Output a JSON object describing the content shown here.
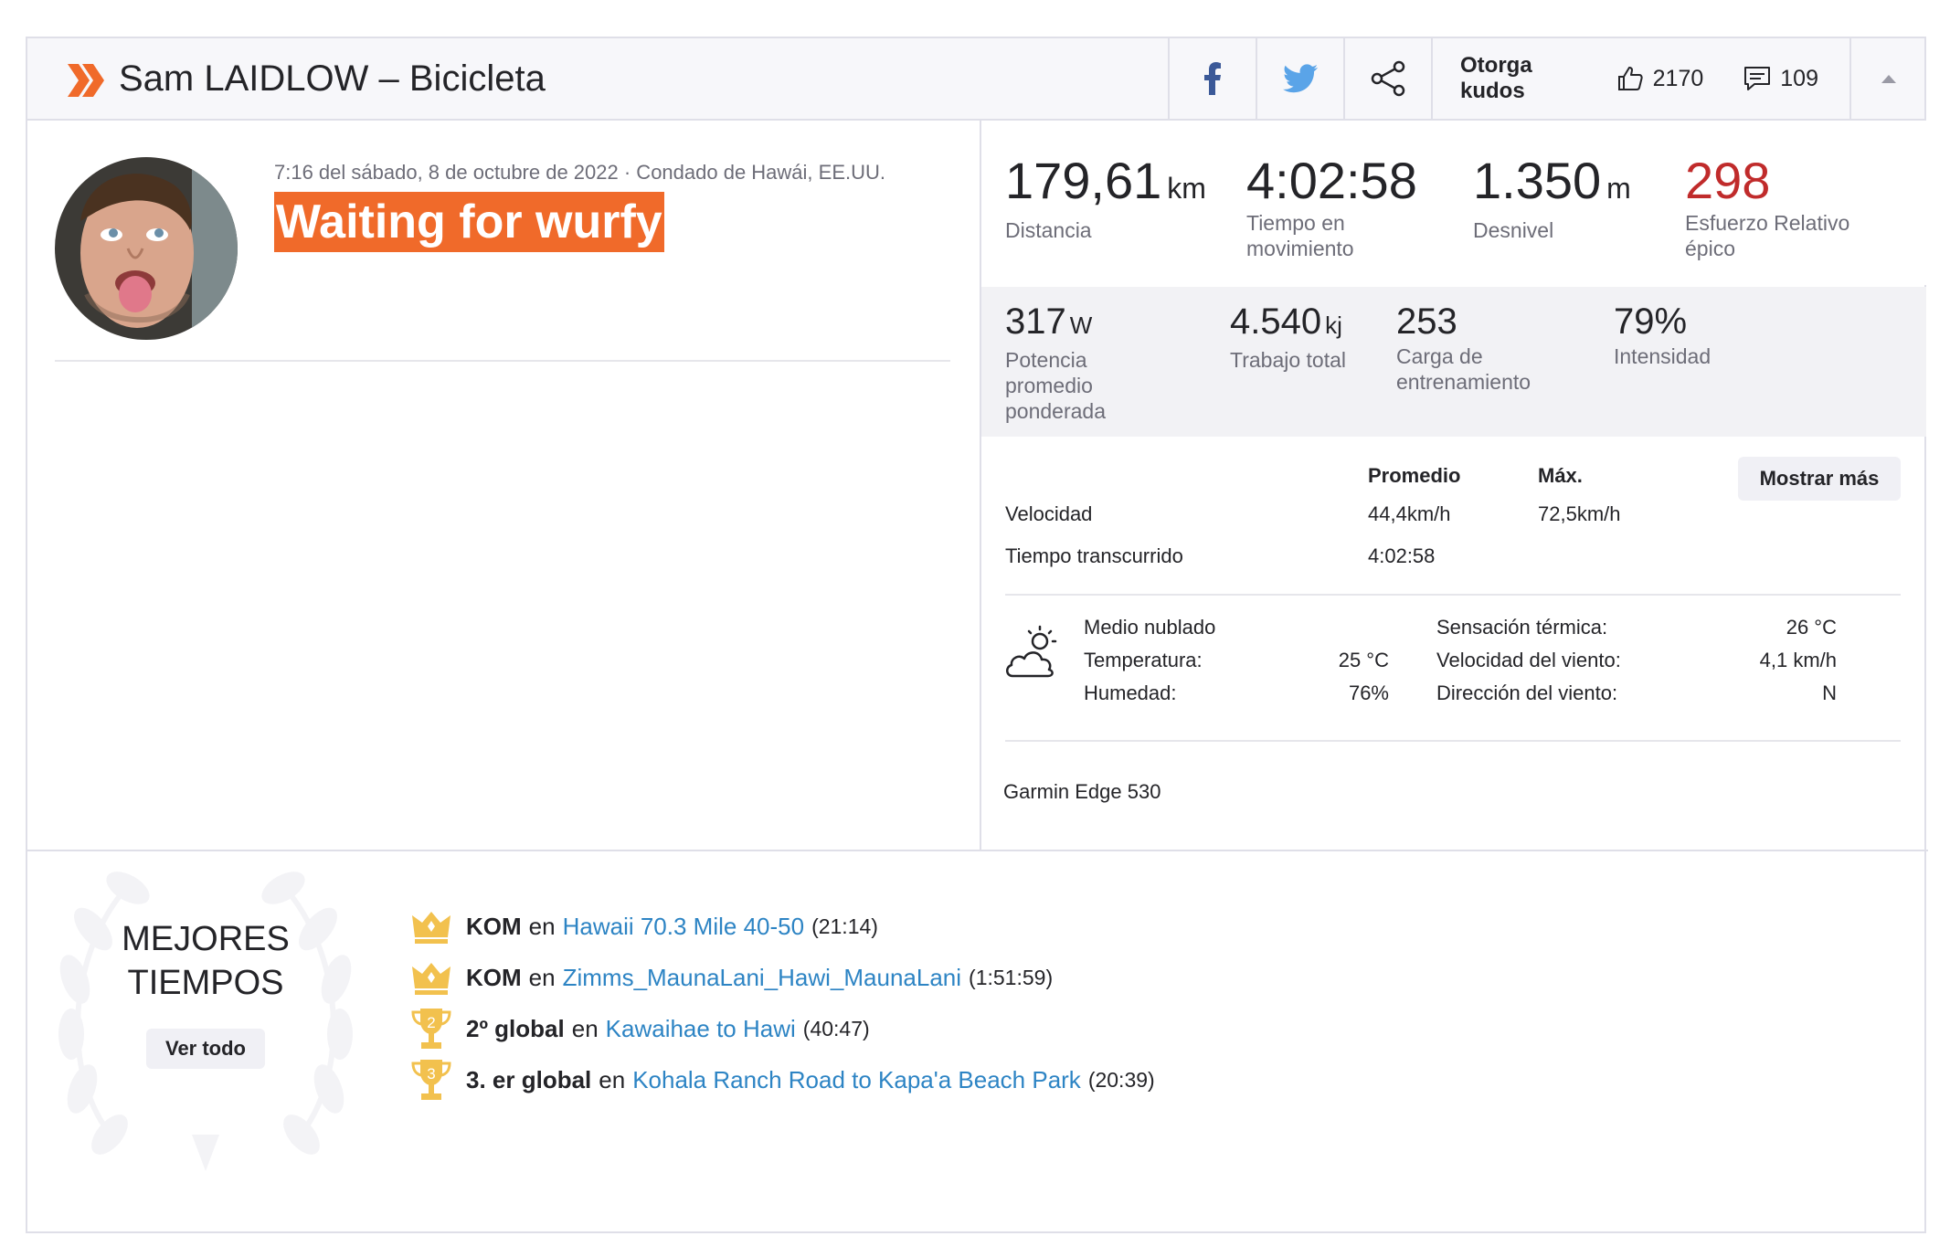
{
  "header": {
    "title": "Sam LAIDLOW – Bicicleta",
    "kudos_label": "Otorga kudos",
    "kudos_count": "2170",
    "comment_count": "109",
    "icons": [
      "strava-logo-icon",
      "facebook-icon",
      "twitter-icon",
      "share-icon",
      "thumbs-up-icon",
      "comment-icon",
      "caret-up-icon"
    ]
  },
  "activity": {
    "dateline": "7:16 del sábado, 8 de octubre de 2022 · Condado de Hawái, EE.UU.",
    "title": "Waiting for wurfy"
  },
  "stats_top": [
    {
      "value": "179,61",
      "unit": "km",
      "label": "Distancia"
    },
    {
      "value": "4:02:58",
      "unit": "",
      "label": "Tiempo en movimiento"
    },
    {
      "value": "1.350",
      "unit": "m",
      "label": "Desnivel"
    },
    {
      "value": "298",
      "unit": "",
      "label": "Esfuerzo Relativo épico"
    }
  ],
  "stats_mid": [
    {
      "value": "317",
      "unit": "W",
      "label": "Potencia promedio ponderada"
    },
    {
      "value": "4.540",
      "unit": "kj",
      "label": "Trabajo total"
    },
    {
      "value": "253",
      "unit": "",
      "label": "Carga de entrenamiento"
    },
    {
      "value": "79%",
      "unit": "",
      "label": "Intensidad"
    }
  ],
  "table": {
    "col_avg": "Promedio",
    "col_max": "Máx.",
    "show_more": "Mostrar más",
    "rows": [
      {
        "label": "Velocidad",
        "avg": "44,4km/h",
        "max": "72,5km/h"
      },
      {
        "label": "Tiempo transcurrido",
        "avg": "4:02:58",
        "max": ""
      }
    ]
  },
  "weather": {
    "condition": "Medio nublado",
    "temp_label": "Temperatura:",
    "temp_value": "25 °C",
    "humidity_label": "Humedad:",
    "humidity_value": "76%",
    "feels_label": "Sensación térmica:",
    "feels_value": "26 °C",
    "wind_speed_label": "Velocidad del viento:",
    "wind_speed_value": "4,1 km/h",
    "wind_dir_label": "Dirección del viento:",
    "wind_dir_value": "N"
  },
  "device": "Garmin Edge 530",
  "achievements": {
    "title_line1": "MEJORES",
    "title_line2": "TIEMPOS",
    "view_all": "Ver todo",
    "items": [
      {
        "rank": "KOM",
        "en": "en",
        "segment": "Hawaii 70.3 Mile 40-50",
        "time": "(21:14)",
        "icon": "crown-icon"
      },
      {
        "rank": "KOM",
        "en": "en",
        "segment": "Zimms_MaunaLani_Hawi_MaunaLani",
        "time": "(1:51:59)",
        "icon": "crown-icon"
      },
      {
        "rank": "2º global",
        "en": "en",
        "segment": "Kawaihae to Hawi",
        "time": "(40:47)",
        "icon": "trophy-2-icon",
        "trophy_number": "2"
      },
      {
        "rank": "3. er global",
        "en": "en",
        "segment": "Kohala Ranch Road to Kapa'a Beach Park",
        "time": "(20:39)",
        "icon": "trophy-3-icon",
        "trophy_number": "3"
      }
    ]
  },
  "colors": {
    "brand_orange": "#f06a2a",
    "link_blue": "#2d84c4",
    "epic_red": "#c02b2b",
    "trophy_gold": "#f2c14e"
  }
}
